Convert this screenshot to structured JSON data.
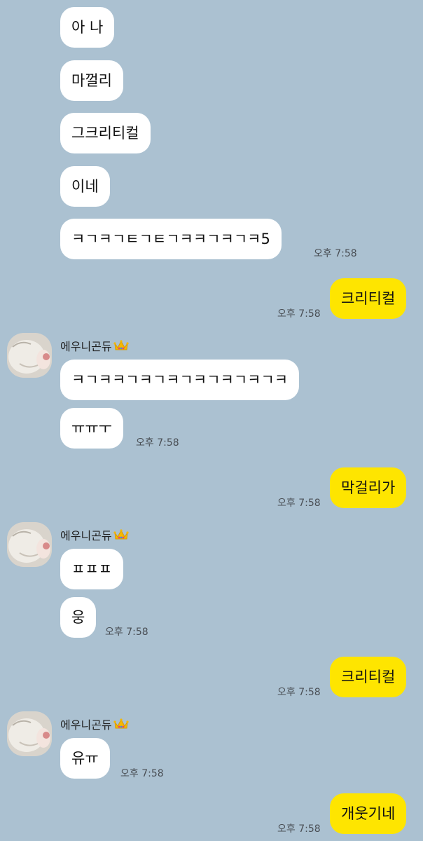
{
  "colors": {
    "background": "#abc1d1",
    "incoming_bubble": "#ffffff",
    "outgoing_bubble": "#fee500",
    "timestamp": "#4a4f55"
  },
  "messages": {
    "m1": "아 나",
    "m2": "마껄리",
    "m3": "그크리티컬",
    "m4": "이네",
    "m5": "ㅋㄱㅋㄱㅌㄱㅌㄱㅋㅋㄱㅋㄱㅋ5",
    "m6": "크리티컬",
    "m7": "ㅋㄱㅋㅋㄱㅋㄱㅋㄱㅋㄱㅋㄱㅋㄱㅋ",
    "m8": "ㅠㅠㅜ",
    "m9": "막걸리가",
    "m10": "ㅍㅍㅍ",
    "m11": "웅",
    "m12": "크리티컬",
    "m13": "유ㅠ",
    "m14": "개웃기네"
  },
  "timestamps": {
    "t1": "오후 7:58",
    "t2": "오후 7:58",
    "t3": "오후 7:58",
    "t4": "오후 7:58",
    "t5": "오후 7:58",
    "t6": "오후 7:58",
    "t7": "오후 7:58",
    "t8": "오후 7:58"
  },
  "sender": {
    "name": "에우니곤듀",
    "crown_icon": "crown-icon",
    "avatar_icon": "cat-avatar"
  }
}
